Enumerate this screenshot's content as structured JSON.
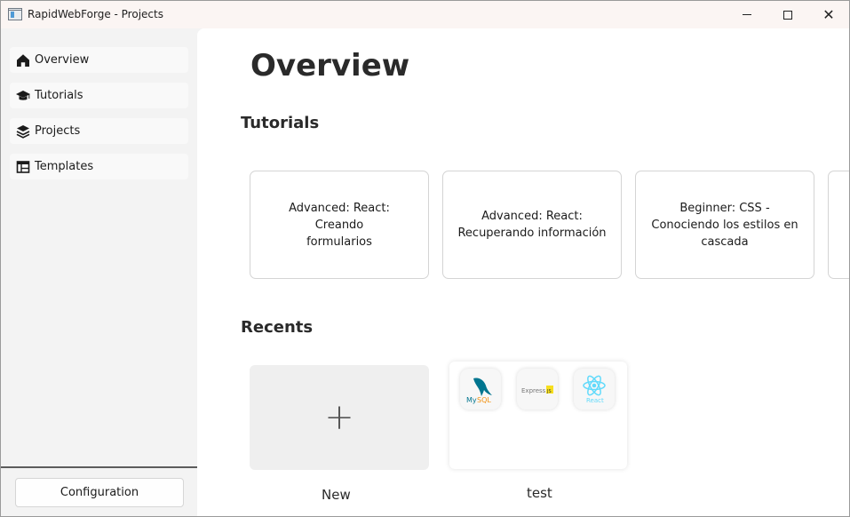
{
  "window": {
    "title": "RapidWebForge - Projects",
    "close_glyph": "✕"
  },
  "sidebar": {
    "items": [
      {
        "label": "Overview",
        "icon": "home-icon"
      },
      {
        "label": "Tutorials",
        "icon": "graduation-cap-icon"
      },
      {
        "label": "Projects",
        "icon": "layers-icon"
      },
      {
        "label": "Templates",
        "icon": "template-icon"
      }
    ],
    "configuration_label": "Configuration"
  },
  "main": {
    "title": "Overview",
    "tutorials_heading": "Tutorials",
    "tutorials": [
      {
        "title": "Advanced: React: Creando formularios"
      },
      {
        "title": "Advanced: React: Recuperando información"
      },
      {
        "title": "Beginner: CSS - Conociendo los estilos en cascada"
      }
    ],
    "recents_heading": "Recents",
    "new_tile": {
      "glyph": "+",
      "label": "New"
    },
    "projects": [
      {
        "label": "test",
        "technologies": [
          "MySQL",
          "Express.js",
          "React"
        ]
      }
    ]
  },
  "colors": {
    "sidebar_bg": "#f3f3f3",
    "main_bg": "#ffffff",
    "titlebar_bg": "#fbf5f3",
    "react_blue": "#61dafb",
    "mysql_blue": "#00758f",
    "mysql_orange": "#f29111",
    "express_yellow": "#f7df1e"
  }
}
